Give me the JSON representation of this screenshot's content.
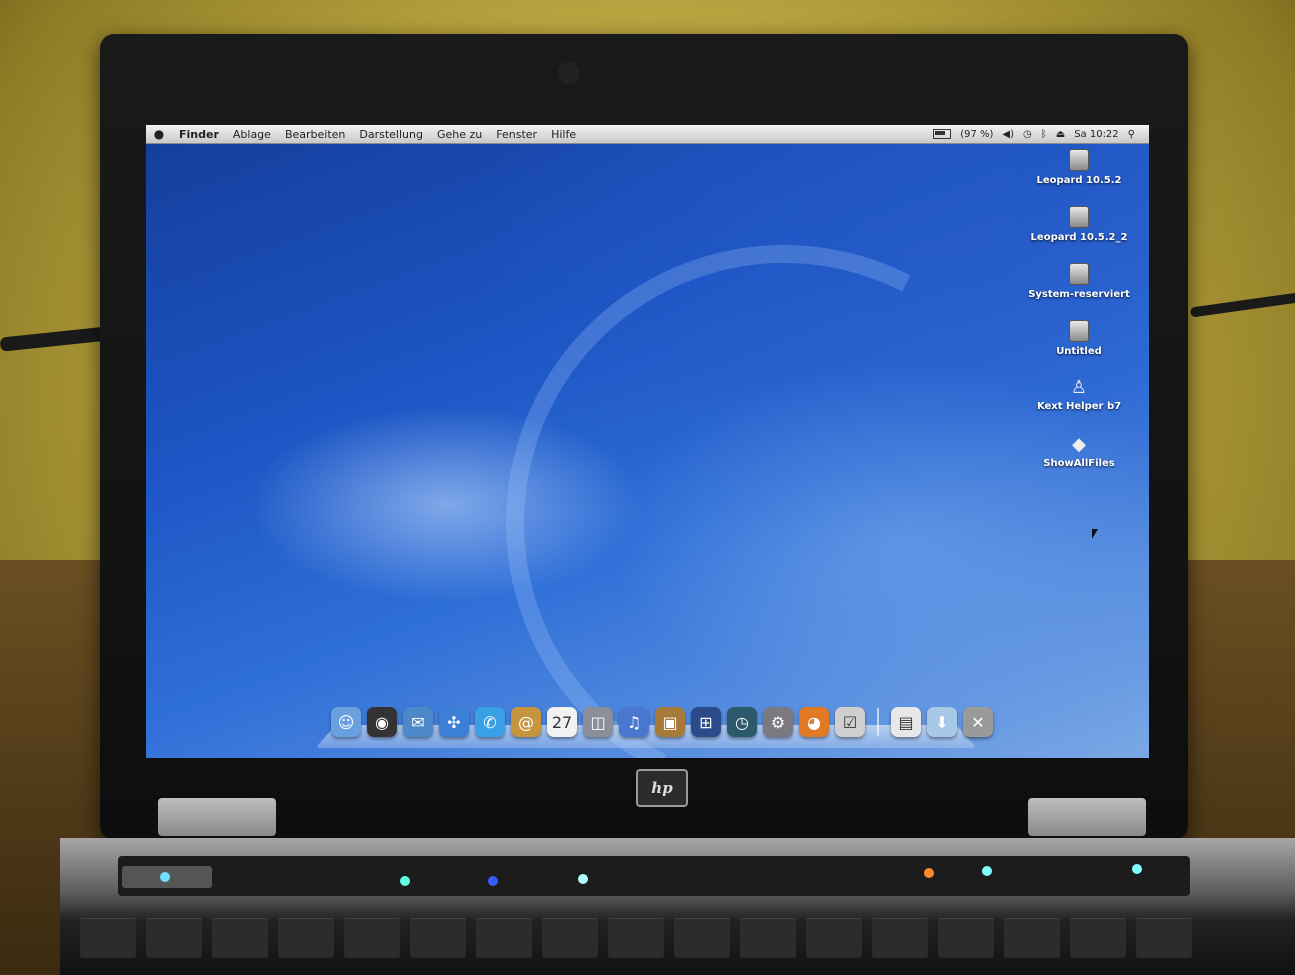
{
  "menubar": {
    "apple_icon": "apple-icon",
    "items": [
      "Finder",
      "Ablage",
      "Bearbeiten",
      "Darstellung",
      "Gehe zu",
      "Fenster",
      "Hilfe"
    ],
    "battery_text": "(97 %)",
    "clock": "Sa 10:22"
  },
  "desktop_icons": [
    {
      "label": "Leopard 10.5.2",
      "icon": "disk-icon"
    },
    {
      "label": "Leopard 10.5.2_2",
      "icon": "disk-icon"
    },
    {
      "label": "System-reserviert",
      "icon": "disk-icon"
    },
    {
      "label": "Untitled",
      "icon": "disk-icon"
    },
    {
      "label": "Kext Helper b7",
      "icon": "app-icon"
    },
    {
      "label": "ShowAllFiles",
      "icon": "app-icon"
    }
  ],
  "dock": {
    "apps": [
      {
        "name": "finder-icon",
        "color": "#6aa0e0",
        "glyph": "☺"
      },
      {
        "name": "dashboard-icon",
        "color": "#333333",
        "glyph": "◉"
      },
      {
        "name": "mail-icon",
        "color": "#4d88c8",
        "glyph": "✉"
      },
      {
        "name": "safari-icon",
        "color": "#3b7fd6",
        "glyph": "✣"
      },
      {
        "name": "ichat-icon",
        "color": "#3aa0e6",
        "glyph": "✆"
      },
      {
        "name": "address-book-icon",
        "color": "#c8953f",
        "glyph": "@"
      },
      {
        "name": "ical-icon",
        "color": "#f2f2f2",
        "glyph": "27"
      },
      {
        "name": "preview-icon",
        "color": "#8a8f99",
        "glyph": "◫"
      },
      {
        "name": "itunes-icon",
        "color": "#4a78d0",
        "glyph": "♫"
      },
      {
        "name": "iphoto-icon",
        "color": "#a87a3a",
        "glyph": "▣"
      },
      {
        "name": "spaces-icon",
        "color": "#2a4a8a",
        "glyph": "⊞"
      },
      {
        "name": "time-machine-icon",
        "color": "#2d5a6a",
        "glyph": "◷"
      },
      {
        "name": "system-preferences-icon",
        "color": "#7a7a80",
        "glyph": "⚙"
      },
      {
        "name": "firefox-icon",
        "color": "#e07a24",
        "glyph": "◕"
      },
      {
        "name": "activity-monitor-icon",
        "color": "#cfcfcf",
        "glyph": "☑"
      }
    ],
    "stacks": [
      {
        "name": "documents-stack-icon",
        "color": "#e8e8e8",
        "glyph": "▤"
      },
      {
        "name": "downloads-stack-icon",
        "color": "#a8c8e8",
        "glyph": "⬇"
      },
      {
        "name": "trash-icon",
        "color": "#9a9a9a",
        "glyph": "✕"
      }
    ]
  },
  "hardware": {
    "logo_text": "hp"
  }
}
